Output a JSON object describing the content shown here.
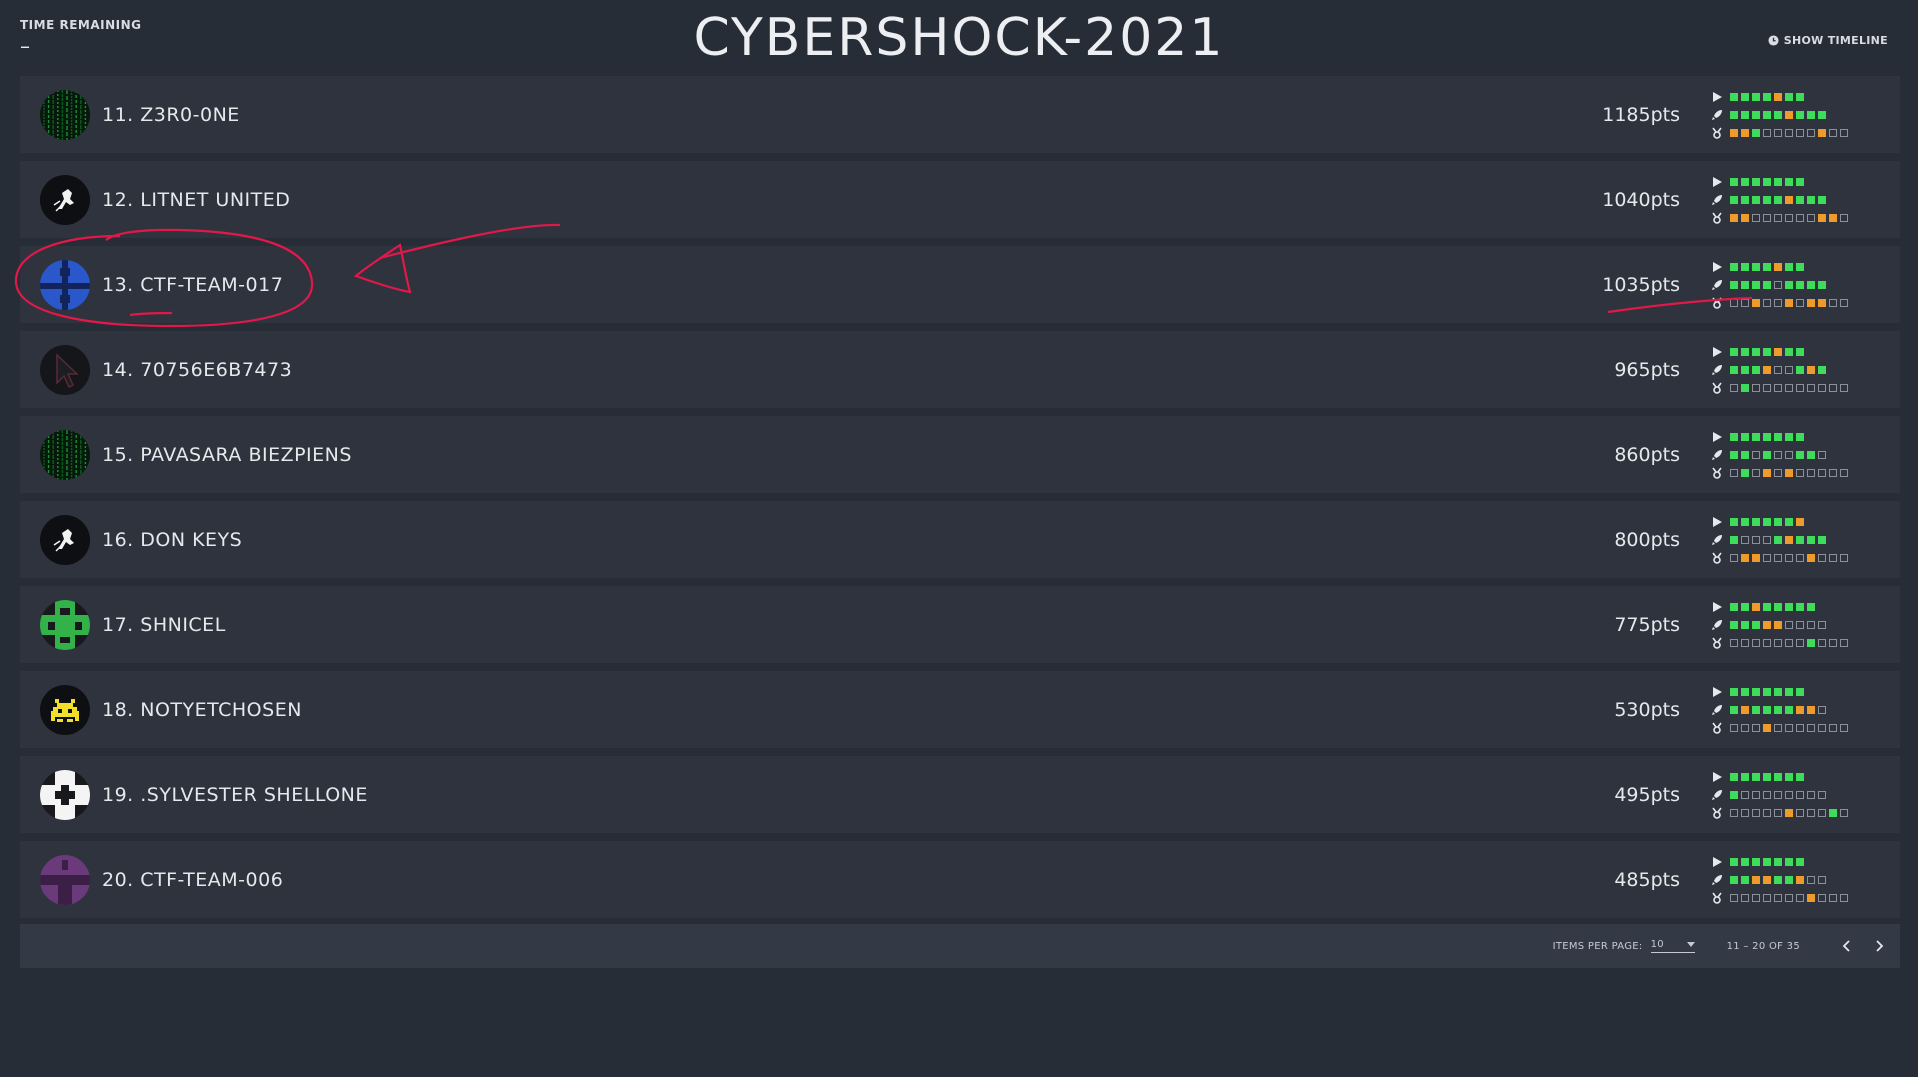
{
  "header": {
    "time_label": "TIME REMAINING",
    "time_value": "–",
    "title": "CYBERSHOCK-2021",
    "timeline_label": "SHOW TIMELINE"
  },
  "colors": {
    "background": "#272d37",
    "row": "#2e333d",
    "solved": "#3fdb5a",
    "first_blood": "#ef9b2b",
    "annotation": "#e0194a"
  },
  "teams": [
    {
      "name": "11. Z3R0-0NE",
      "points": "1185pts",
      "avatar": "matrix-green",
      "tracks": [
        "ggggogg",
        "gggggoggg",
        "oogeeeeeoee"
      ]
    },
    {
      "name": "12. LITNET UNITED",
      "points": "1040pts",
      "avatar": "astronaut-white",
      "tracks": [
        "ggggggg",
        "gggggoggg",
        "ooeeeeeeooe"
      ]
    },
    {
      "name": "13. CTF-TEAM-017",
      "points": "1035pts",
      "avatar": "pixel-blue",
      "tracks": [
        "ggggogg",
        "ggggegggg",
        "eeoeeoeooee"
      ]
    },
    {
      "name": "14. 70756E6B7473",
      "points": "965pts",
      "avatar": "cursor-dark",
      "tracks": [
        "ggggogg",
        "gggoeegog",
        "egeeeeeeeee"
      ]
    },
    {
      "name": "15. PAVASARA BIEZPIENS",
      "points": "860pts",
      "avatar": "matrix-green",
      "tracks": [
        "ggggggg",
        "ggegeegge",
        "egeoeoeeeee"
      ]
    },
    {
      "name": "16. DON KEYS",
      "points": "800pts",
      "avatar": "astronaut-white",
      "tracks": [
        "ggggggo",
        "geeegoggg",
        "eooeeeeoeee"
      ]
    },
    {
      "name": "17. SHNICEL",
      "points": "775pts",
      "avatar": "pixel-green",
      "tracks": [
        "ggoggggg",
        "gggooeeee",
        "eeeeeeegeee"
      ]
    },
    {
      "name": "18. NOTYETCHOSEN",
      "points": "530pts",
      "avatar": "invader-yellow",
      "tracks": [
        "ggggggg",
        "goggggooe",
        "eeeoeeeeeee"
      ]
    },
    {
      "name": "19. .SYLVESTER SHELLONE",
      "points": "495pts",
      "avatar": "pixel-white",
      "tracks": [
        "ggggggg",
        "geeeeeeee",
        "eeeeeoeeege"
      ]
    },
    {
      "name": "20. CTF-TEAM-006",
      "points": "485pts",
      "avatar": "pixel-purple",
      "tracks": [
        "ggggggg",
        "ggooggoee",
        "eeeeeeeoeee"
      ]
    }
  ],
  "footer": {
    "items_per_page_label": "ITEMS PER PAGE:",
    "items_per_page_value": "10",
    "range": "11 – 20 OF 35"
  }
}
